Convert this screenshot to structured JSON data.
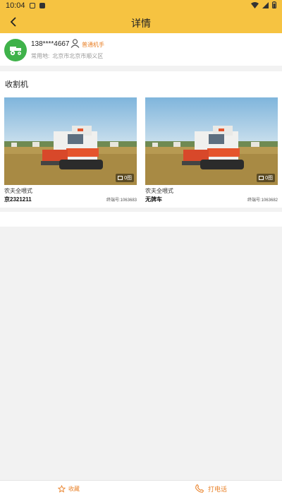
{
  "status_bar": {
    "time": "10:04"
  },
  "header": {
    "title": "详情",
    "back_icon": "chevron-left-icon"
  },
  "user": {
    "phone": "138****4667",
    "role": "普通机手",
    "location_label": "常用地:",
    "location_value": "北京市北京市顺义区"
  },
  "section": {
    "title": "收割机",
    "items": [
      {
        "brand": "农夫全喂式",
        "plate": "京2321211",
        "terminal": "终端号:1063683",
        "photo_count": "0图"
      },
      {
        "brand": "农夫全喂式",
        "plate": "无牌车",
        "terminal": "终端号:1063682",
        "photo_count": "0图"
      }
    ]
  },
  "bottom_bar": {
    "favorite_label": "收藏",
    "call_label": "打电话"
  },
  "colors": {
    "accent": "#f6c341",
    "orange": "#e9822a",
    "avatar_green": "#3fb24a"
  }
}
